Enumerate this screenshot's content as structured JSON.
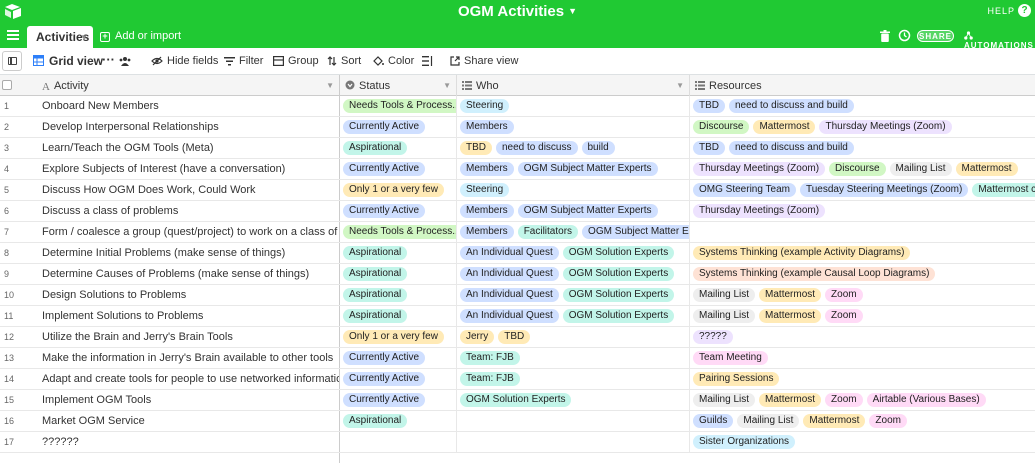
{
  "app": {
    "title": "OGM Activities",
    "help": "HELP",
    "help_q": "?"
  },
  "tabs": {
    "active": "Activities",
    "add_import": "Add or import",
    "share": "SHARE",
    "automations": "AUTOMATIONS"
  },
  "viewbar": {
    "view_name": "Grid view",
    "more": "···",
    "hide_fields": "Hide fields",
    "filter": "Filter",
    "group": "Group",
    "sort": "Sort",
    "color": "Color",
    "share_view": "Share view"
  },
  "columns": {
    "activity": "Activity",
    "status": "Status",
    "who": "Who",
    "resources": "Resources"
  },
  "colors": {
    "green": "#20c933",
    "chip": {
      "needs": "#d1f7c4",
      "active": "#cfdfff",
      "aspirational": "#c2f5e9",
      "few": "#ffeab6",
      "blue": "#cfdfff",
      "teal": "#c2f5e9",
      "yellow": "#ffeab6",
      "green": "#d1f7c4",
      "purple": "#ede2fe",
      "grey": "#eeeeee",
      "pink": "#ffdaf6",
      "orange": "#fee2d5",
      "cyan": "#d0f0fd"
    }
  },
  "rows": [
    {
      "num": "1",
      "activity": "Onboard New Members",
      "status": {
        "label": "Needs Tools & Process...",
        "color": "needs"
      },
      "who": [
        {
          "label": "Steering",
          "color": "cyan"
        }
      ],
      "resources": [
        {
          "label": "TBD",
          "color": "blue"
        },
        {
          "label": "need to discuss and build",
          "color": "blue"
        }
      ]
    },
    {
      "num": "2",
      "activity": "Develop Interpersonal Relationships",
      "status": {
        "label": "Currently Active",
        "color": "active"
      },
      "who": [
        {
          "label": "Members",
          "color": "blue"
        }
      ],
      "resources": [
        {
          "label": "Discourse",
          "color": "green"
        },
        {
          "label": "Mattermost",
          "color": "yellow"
        },
        {
          "label": "Thursday Meetings (Zoom)",
          "color": "purple"
        }
      ]
    },
    {
      "num": "3",
      "activity": "Learn/Teach the OGM Tools (Meta)",
      "status": {
        "label": "Aspirational",
        "color": "aspirational"
      },
      "who": [
        {
          "label": "TBD",
          "color": "yellow"
        },
        {
          "label": "need to discuss",
          "color": "blue"
        },
        {
          "label": "build",
          "color": "blue"
        }
      ],
      "resources": [
        {
          "label": "TBD",
          "color": "blue"
        },
        {
          "label": "need to discuss and build",
          "color": "blue"
        }
      ]
    },
    {
      "num": "4",
      "activity": "Explore Subjects of Interest (have a conversation)",
      "status": {
        "label": "Currently Active",
        "color": "active"
      },
      "who": [
        {
          "label": "Members",
          "color": "blue"
        },
        {
          "label": "OGM Subject Matter Experts",
          "color": "blue"
        }
      ],
      "resources": [
        {
          "label": "Thursday Meetings (Zoom)",
          "color": "purple"
        },
        {
          "label": "Discourse",
          "color": "green"
        },
        {
          "label": "Mailing List",
          "color": "grey"
        },
        {
          "label": "Mattermost",
          "color": "yellow"
        }
      ]
    },
    {
      "num": "5",
      "activity": "Discuss How OGM Does Work, Could Work",
      "status": {
        "label": "Only 1 or a very few",
        "color": "few"
      },
      "who": [
        {
          "label": "Steering",
          "color": "cyan"
        }
      ],
      "resources": [
        {
          "label": "OMG Steering Team",
          "color": "blue"
        },
        {
          "label": "Tuesday Steering Meetings (Zoom)",
          "color": "blue"
        },
        {
          "label": "Mattermost channel",
          "color": "teal"
        }
      ]
    },
    {
      "num": "6",
      "activity": "Discuss a class of problems",
      "status": {
        "label": "Currently Active",
        "color": "active"
      },
      "who": [
        {
          "label": "Members",
          "color": "blue"
        },
        {
          "label": "OGM Subject Matter Experts",
          "color": "blue"
        }
      ],
      "resources": [
        {
          "label": "Thursday Meetings (Zoom)",
          "color": "purple"
        }
      ]
    },
    {
      "num": "7",
      "activity": "Form / coalesce a group (quest/project) to work on a class of problems",
      "status": {
        "label": "Needs Tools & Process...",
        "color": "needs"
      },
      "who": [
        {
          "label": "Members",
          "color": "blue"
        },
        {
          "label": "Facilitators",
          "color": "teal"
        },
        {
          "label": "OGM Subject Matter Experts",
          "color": "blue"
        }
      ],
      "resources": []
    },
    {
      "num": "8",
      "activity": "Determine Initial Problems (make sense of things)",
      "status": {
        "label": "Aspirational",
        "color": "aspirational"
      },
      "who": [
        {
          "label": "An Individual Quest",
          "color": "blue"
        },
        {
          "label": "OGM Solution Experts",
          "color": "teal"
        }
      ],
      "resources": [
        {
          "label": "Systems Thinking (example Activity Diagrams)",
          "color": "yellow"
        }
      ]
    },
    {
      "num": "9",
      "activity": "Determine Causes of Problems (make sense of things)",
      "status": {
        "label": "Aspirational",
        "color": "aspirational"
      },
      "who": [
        {
          "label": "An Individual Quest",
          "color": "blue"
        },
        {
          "label": "OGM Solution Experts",
          "color": "teal"
        }
      ],
      "resources": [
        {
          "label": "Systems Thinking (example Causal Loop Diagrams)",
          "color": "orange"
        }
      ]
    },
    {
      "num": "10",
      "activity": "Design Solutions to Problems",
      "status": {
        "label": "Aspirational",
        "color": "aspirational"
      },
      "who": [
        {
          "label": "An Individual Quest",
          "color": "blue"
        },
        {
          "label": "OGM Solution Experts",
          "color": "teal"
        }
      ],
      "resources": [
        {
          "label": "Mailing List",
          "color": "grey"
        },
        {
          "label": "Mattermost",
          "color": "yellow"
        },
        {
          "label": "Zoom",
          "color": "pink"
        }
      ]
    },
    {
      "num": "11",
      "activity": "Implement Solutions to Problems",
      "status": {
        "label": "Aspirational",
        "color": "aspirational"
      },
      "who": [
        {
          "label": "An Individual Quest",
          "color": "blue"
        },
        {
          "label": "OGM Solution Experts",
          "color": "teal"
        }
      ],
      "resources": [
        {
          "label": "Mailing List",
          "color": "grey"
        },
        {
          "label": "Mattermost",
          "color": "yellow"
        },
        {
          "label": "Zoom",
          "color": "pink"
        }
      ]
    },
    {
      "num": "12",
      "activity": "Utilize the Brain and Jerry's Brain Tools",
      "status": {
        "label": "Only 1 or a very few",
        "color": "few"
      },
      "who": [
        {
          "label": "Jerry",
          "color": "yellow"
        },
        {
          "label": "TBD",
          "color": "yellow"
        }
      ],
      "resources": [
        {
          "label": "?????",
          "color": "purple"
        }
      ]
    },
    {
      "num": "13",
      "activity": "Make the information in Jerry's Brain available to other tools",
      "status": {
        "label": "Currently Active",
        "color": "active"
      },
      "who": [
        {
          "label": "Team: FJB",
          "color": "teal"
        }
      ],
      "resources": [
        {
          "label": "Team Meeting",
          "color": "pink"
        }
      ]
    },
    {
      "num": "14",
      "activity": "Adapt and create tools for people to use networked information together",
      "status": {
        "label": "Currently Active",
        "color": "active"
      },
      "who": [
        {
          "label": "Team: FJB",
          "color": "teal"
        }
      ],
      "resources": [
        {
          "label": "Pairing Sessions",
          "color": "yellow"
        }
      ]
    },
    {
      "num": "15",
      "activity": "Implement OGM Tools",
      "status": {
        "label": "Currently Active",
        "color": "active"
      },
      "who": [
        {
          "label": "OGM Solution Experts",
          "color": "teal"
        }
      ],
      "resources": [
        {
          "label": "Mailing List",
          "color": "grey"
        },
        {
          "label": "Mattermost",
          "color": "yellow"
        },
        {
          "label": "Zoom",
          "color": "pink"
        },
        {
          "label": "Airtable (Various Bases)",
          "color": "pink"
        }
      ]
    },
    {
      "num": "16",
      "activity": "Market OGM Service",
      "status": {
        "label": "Aspirational",
        "color": "aspirational"
      },
      "who": [],
      "resources": [
        {
          "label": "Guilds",
          "color": "blue"
        },
        {
          "label": "Mailing List",
          "color": "grey"
        },
        {
          "label": "Mattermost",
          "color": "yellow"
        },
        {
          "label": "Zoom",
          "color": "pink"
        }
      ]
    },
    {
      "num": "17",
      "activity": "??????",
      "status": null,
      "who": [],
      "resources": [
        {
          "label": "Sister Organizations",
          "color": "cyan"
        }
      ]
    }
  ]
}
